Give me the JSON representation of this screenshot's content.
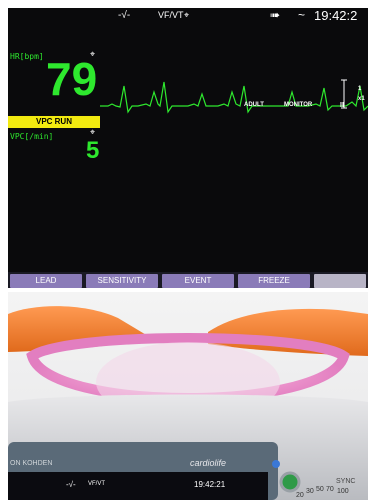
{
  "monitor": {
    "status": {
      "ecg_symbol": "-√-",
      "alarm_text": "VF/VT",
      "alarm_muted_icon": "⌖",
      "power_icon": "➠",
      "ac_icon": "~",
      "time": "19:42:2"
    },
    "hr": {
      "label": "HR[bpm]",
      "value": "79"
    },
    "vpc_run": "VPC RUN",
    "vpc": {
      "label": "VPC[/min]",
      "value": "5"
    },
    "wave": {
      "mode": "ADULT",
      "source": "MONITOR",
      "lead": "II",
      "scale_top": "1",
      "scale_bottom": "x1"
    },
    "function_keys": [
      "LEAD",
      "SENSITIVITY",
      "EVENT",
      "FREEZE",
      ""
    ],
    "colors": {
      "hr": "#2ee82e",
      "alarm": "#f2ea10",
      "key": "#8a7bb8"
    }
  },
  "device": {
    "brand": "ON KOHDEN",
    "model": "cardiolife",
    "small_status": {
      "ecg_symbol": "-√-",
      "alarm_text": "VF/VT",
      "time": "19:42:21"
    },
    "sync": "SYNC",
    "energy_scale": [
      "20",
      "30",
      "50",
      "70",
      "100"
    ]
  }
}
